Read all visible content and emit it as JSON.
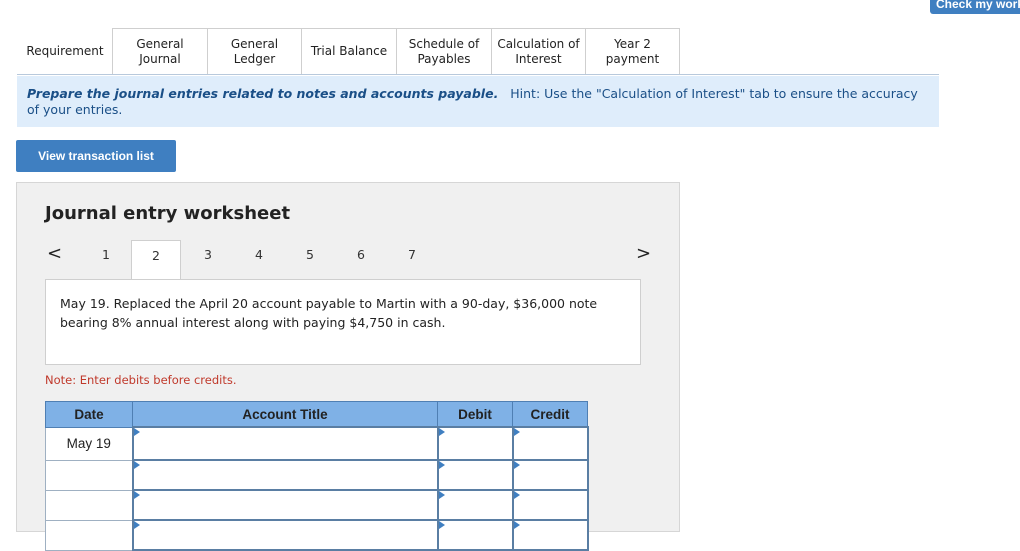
{
  "top_button": {
    "label": "Check my work"
  },
  "tabs": [
    {
      "line1": "Requirement",
      "line2": ""
    },
    {
      "line1": "General",
      "line2": "Journal"
    },
    {
      "line1": "General",
      "line2": "Ledger"
    },
    {
      "line1": "Trial Balance",
      "line2": ""
    },
    {
      "line1": "Schedule of",
      "line2": "Payables"
    },
    {
      "line1": "Calculation of",
      "line2": "Interest"
    },
    {
      "line1": "Year 2",
      "line2": "payment"
    }
  ],
  "instruction": {
    "main": "Prepare the journal entries related to notes and accounts payable.",
    "hint": "Hint:  Use the \"Calculation of Interest\" tab to ensure the accuracy of your entries."
  },
  "view_button": {
    "label": "View transaction list"
  },
  "worksheet": {
    "title": "Journal entry worksheet",
    "prev_arrow": "<",
    "next_arrow": ">",
    "pages": [
      "1",
      "2",
      "3",
      "4",
      "5",
      "6",
      "7"
    ],
    "active_page": "2",
    "description": "May 19. Replaced the April 20 account payable to Martin with a 90-day, $36,000 note bearing 8% annual interest along with paying $4,750 in cash.",
    "note": "Note: Enter debits before credits.",
    "table": {
      "headers": [
        "Date",
        "Account Title",
        "Debit",
        "Credit"
      ],
      "rows": [
        {
          "date": "May 19"
        },
        {
          "date": ""
        },
        {
          "date": ""
        },
        {
          "date": ""
        }
      ]
    }
  },
  "colors": {
    "accent": "#3f7fc1",
    "instruction_bg": "#dfedfb",
    "table_header": "#7fb1e6",
    "note_text": "#c0392b"
  }
}
